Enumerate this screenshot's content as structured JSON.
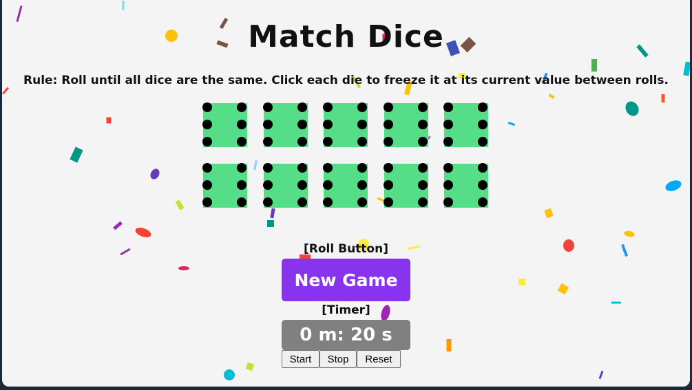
{
  "title": "Match Dice",
  "rule": "Rule: Roll until all dice are the same. Click each die to freeze it at its current value between rolls.",
  "dice": [
    6,
    6,
    6,
    6,
    6,
    6,
    6,
    6,
    6,
    6
  ],
  "dice_color": "#55dd88",
  "roll_label": "[Roll Button]",
  "new_game_label": "New Game",
  "timer_label": "[Timer]",
  "timer_value": "0 m: 20 s",
  "controls": {
    "start": "Start",
    "stop": "Stop",
    "reset": "Reset"
  },
  "colors": {
    "accent": "#8833ee",
    "timer_bg": "#808080",
    "page_bg": "#f4f4f4"
  }
}
